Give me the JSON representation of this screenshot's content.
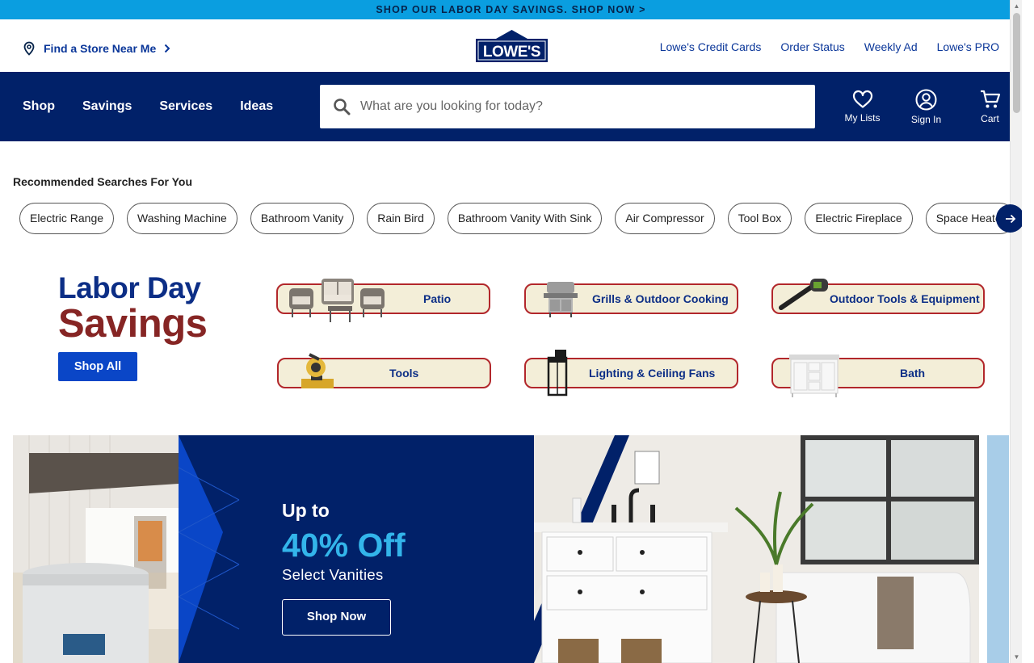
{
  "promo": {
    "text": "SHOP OUR LABOR DAY SAVINGS. SHOP NOW >"
  },
  "header": {
    "find_store": "Find a Store Near Me",
    "logo_text": "LOWE'S",
    "links": [
      "Lowe's Credit Cards",
      "Order Status",
      "Weekly Ad",
      "Lowe's PRO"
    ]
  },
  "nav": {
    "menu": [
      "Shop",
      "Savings",
      "Services",
      "Ideas"
    ],
    "search_placeholder": "What are you looking for today?",
    "actions": {
      "lists": "My Lists",
      "signin": "Sign In",
      "cart": "Cart"
    }
  },
  "recommended": {
    "title": "Recommended Searches For You",
    "chips": [
      "Electric Range",
      "Washing Machine",
      "Bathroom Vanity",
      "Rain Bird",
      "Bathroom Vanity With Sink",
      "Air Compressor",
      "Tool Box",
      "Electric Fireplace",
      "Space Heater"
    ]
  },
  "labor_day": {
    "line1": "Labor Day",
    "line2": "Savings",
    "button": "Shop All",
    "categories": [
      "Patio",
      "Grills & Outdoor Cooking",
      "Outdoor Tools & Equipment",
      "Tools",
      "Lighting & Ceiling Fans",
      "Bath"
    ]
  },
  "hero": {
    "up_to": "Up to",
    "discount": "40% Off",
    "subtitle": "Select Vanities",
    "button": "Shop Now"
  },
  "colors": {
    "nav_bg": "#012169",
    "promo_bg": "#0a9ee0",
    "savings_red": "#862524",
    "accent_blue": "#0a46c7"
  }
}
